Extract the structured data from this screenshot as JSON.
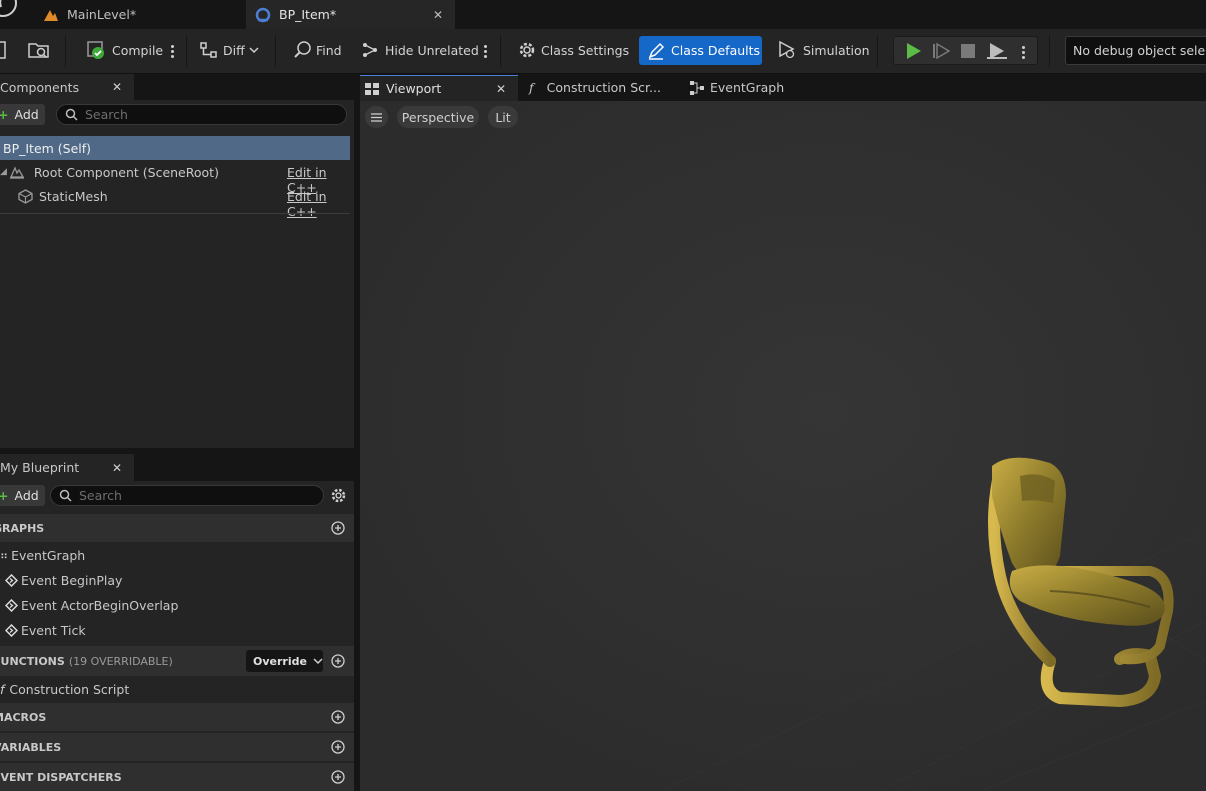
{
  "document_tabs": [
    {
      "label": "MainLevel*",
      "icon": "level-icon"
    },
    {
      "label": "BP_Item*",
      "icon": "blueprint-icon",
      "active": true
    }
  ],
  "toolbar": {
    "compile": "Compile",
    "diff": "Diff",
    "find": "Find",
    "hide_unrelated": "Hide Unrelated",
    "class_settings": "Class Settings",
    "class_defaults": "Class Defaults",
    "simulation": "Simulation",
    "debug_object": "No debug object selected"
  },
  "components": {
    "title": "Components",
    "add_label": "Add",
    "search_placeholder": "Search",
    "self_item": "BP_Item (Self)",
    "items": [
      {
        "label": "Root Component (SceneRoot)",
        "action": "Edit in C++"
      },
      {
        "label": "StaticMesh",
        "action": "Edit in C++"
      }
    ]
  },
  "my_blueprint": {
    "title": "My Blueprint",
    "add_label": "Add",
    "search_placeholder": "Search",
    "sections": {
      "graphs": "GRAPHS",
      "functions": "FUNCTIONS",
      "functions_count": "(19 OVERRIDABLE)",
      "override": "Override",
      "macros": "MACROS",
      "variables": "VARIABLES",
      "event_dispatchers": "EVENT DISPATCHERS"
    },
    "graph_items": [
      "EventGraph",
      "Event BeginPlay",
      "Event ActorBeginOverlap",
      "Event Tick"
    ],
    "function_items": [
      "Construction Script"
    ]
  },
  "editor_tabs": [
    {
      "label": "Viewport",
      "active": true
    },
    {
      "label": "Construction Scr..."
    },
    {
      "label": "EventGraph"
    }
  ],
  "viewport": {
    "perspective": "Perspective",
    "lit": "Lit"
  },
  "colors": {
    "accent": "#1567c8",
    "selection": "#4f6987",
    "play_green": "#5bbd45"
  }
}
